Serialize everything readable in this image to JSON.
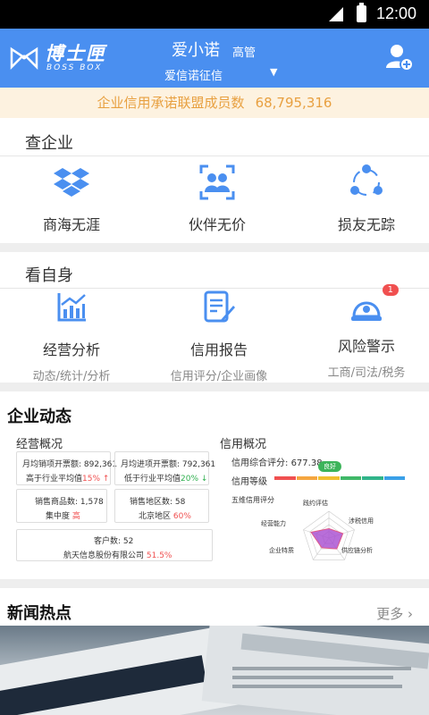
{
  "status_bar": {
    "time": "12:00"
  },
  "header": {
    "logo_name": "博士匣",
    "logo_sub": "BOSS BOX",
    "user_name": "爱小诺",
    "user_role": "高管",
    "org_name": "爱信诺征信"
  },
  "banner": {
    "label": "企业信用承诺联盟成员数",
    "count": "68,795,316"
  },
  "check_company": {
    "title": "查企业",
    "items": [
      {
        "label": "商海无涯",
        "icon": "dropbox-icon"
      },
      {
        "label": "伙伴无价",
        "icon": "partners-icon"
      },
      {
        "label": "损友无踪",
        "icon": "share-nodes-icon"
      }
    ]
  },
  "self_check": {
    "title": "看自身",
    "items": [
      {
        "label": "经营分析",
        "sub": "动态/统计/分析",
        "icon": "chart-icon"
      },
      {
        "label": "信用报告",
        "sub": "信用评分/企业画像",
        "icon": "report-icon"
      },
      {
        "label": "风险警示",
        "sub": "工商/司法/税务",
        "icon": "alarm-icon",
        "badge": "1"
      }
    ]
  },
  "dynamics": {
    "title": "企业动态",
    "operations": {
      "title": "经营概况",
      "sales_invoice_label": "月均销项开票额:",
      "sales_invoice_value": "892,361",
      "sales_compare_prefix": "高于行业平均值",
      "sales_compare_value": "15%",
      "purchase_invoice_label": "月均进项开票额:",
      "purchase_invoice_value": "792,361",
      "purchase_compare_prefix": "低于行业平均值",
      "purchase_compare_value": "20%",
      "goods_count_label": "销售商品数:",
      "goods_count_value": "1,578",
      "concentration_label": "集中度",
      "concentration_value": "高",
      "region_count_label": "销售地区数:",
      "region_count_value": "58",
      "region_top_label": "北京地区",
      "region_top_value": "60%",
      "customer_count_label": "客户数:",
      "customer_count_value": "52",
      "top_customer_label": "航天信息股份有限公司",
      "top_customer_value": "51.5%"
    },
    "credit": {
      "title": "信用概况",
      "score_label": "信用综合评分:",
      "score_value": "677.38",
      "level_label": "信用等级",
      "level_tag": "良好",
      "level_segments": [
        "#f05050",
        "#f5a640",
        "#f0c030",
        "#40b868",
        "#30b48a",
        "#3aa0e8"
      ],
      "radar_title": "五维信用评分",
      "radar_axes": [
        "践约评估",
        "涉税信用",
        "供应链分析",
        "企业特质",
        "经营能力"
      ],
      "radar_values": [
        0.35,
        0.55,
        0.5,
        0.45,
        0.7
      ]
    }
  },
  "news": {
    "title": "新闻热点",
    "more": "更多"
  }
}
